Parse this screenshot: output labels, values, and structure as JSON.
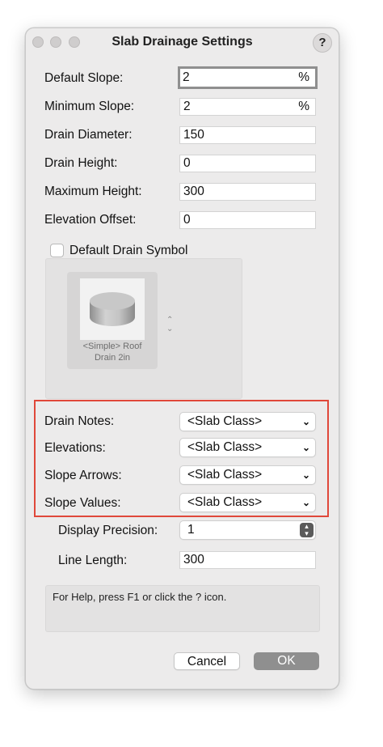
{
  "window": {
    "title": "Slab Drainage Settings",
    "help_label": "?"
  },
  "fields": {
    "default_slope": {
      "label": "Default Slope:",
      "value": "2",
      "unit": "%"
    },
    "minimum_slope": {
      "label": "Minimum Slope:",
      "value": "2",
      "unit": "%"
    },
    "drain_diameter": {
      "label": "Drain Diameter:",
      "value": "150"
    },
    "drain_height": {
      "label": "Drain Height:",
      "value": "0"
    },
    "maximum_height": {
      "label": "Maximum Height:",
      "value": "300"
    },
    "elevation_offset": {
      "label": "Elevation Offset:",
      "value": "0"
    }
  },
  "default_drain_symbol": {
    "label": "Default Drain Symbol",
    "checked": false,
    "symbol_caption_line1": "<Simple> Roof",
    "symbol_caption_line2": "Drain 2in"
  },
  "classes": {
    "drain_notes": {
      "label": "Drain Notes:",
      "value": "<Slab Class>"
    },
    "elevations": {
      "label": "Elevations:",
      "value": "<Slab Class>"
    },
    "slope_arrows": {
      "label": "Slope Arrows:",
      "value": "<Slab Class>"
    },
    "slope_values": {
      "label": "Slope Values:",
      "value": "<Slab Class>"
    }
  },
  "display_precision": {
    "label": "Display Precision:",
    "value": "1"
  },
  "line_length": {
    "label": "Line Length:",
    "value": "300"
  },
  "help_text": "For Help, press F1 or click the ? icon.",
  "buttons": {
    "cancel": "Cancel",
    "ok": "OK"
  },
  "colors": {
    "highlight_border": "#e0483a",
    "ok_button": "#8f8f8f"
  }
}
